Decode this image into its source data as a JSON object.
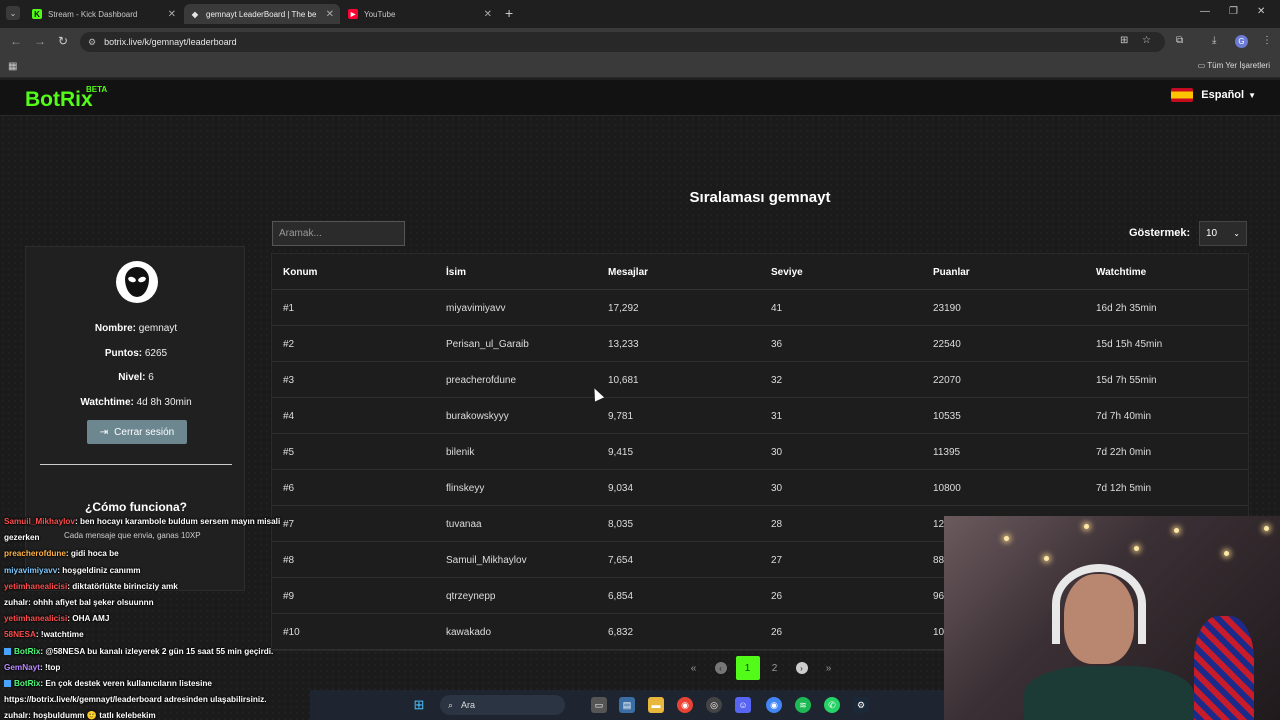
{
  "browser": {
    "tabs": [
      {
        "title": "Stream - Kick Dashboard",
        "icon": "kick-icon",
        "color": "#53fc18"
      },
      {
        "title": "gemnayt LeaderBoard | The be",
        "icon": "botrix-icon",
        "color": "#e6e6e6"
      },
      {
        "title": "YouTube",
        "icon": "youtube-icon",
        "color": "#ff0033"
      }
    ],
    "url": "botrix.live/k/gemnayt/leaderboard",
    "bookmarks_label": "Tüm Yer İşaretleri",
    "profile_initial": "G"
  },
  "site": {
    "logo": "BotRix",
    "beta": "BETA",
    "language": "Español",
    "page_title": "Sıralaması gemnayt",
    "search_placeholder": "Aramak...",
    "show_label": "Göstermek:",
    "show_value": "10"
  },
  "profile": {
    "name_label": "Nombre:",
    "name": "gemnayt",
    "points_label": "Puntos:",
    "points": "6265",
    "level_label": "Nivel:",
    "level": "6",
    "watchtime_label": "Watchtime:",
    "watchtime": "4d 8h 30min",
    "logout": "Cerrar sesión",
    "how_title": "¿Cómo funciona?",
    "how_text": "Cada mensaje que envia, ganas 10XP"
  },
  "table": {
    "headers": [
      "Konum",
      "İsim",
      "Mesajlar",
      "Seviye",
      "Puanlar",
      "Watchtime"
    ],
    "rows": [
      [
        "#1",
        "miyavimiyavv",
        "17,292",
        "41",
        "23190",
        "16d 2h 35min"
      ],
      [
        "#2",
        "Perisan_ul_Garaib",
        "13,233",
        "36",
        "22540",
        "15d 15h 45min"
      ],
      [
        "#3",
        "preacherofdune",
        "10,681",
        "32",
        "22070",
        "15d 7h 55min"
      ],
      [
        "#4",
        "burakowskyyy",
        "9,781",
        "31",
        "10535",
        "7d 7h 40min"
      ],
      [
        "#5",
        "bilenik",
        "9,415",
        "30",
        "11395",
        "7d 22h 0min"
      ],
      [
        "#6",
        "flinskeyy",
        "9,034",
        "30",
        "10800",
        "7d 12h 5min"
      ],
      [
        "#7",
        "tuvanaa",
        "8,035",
        "28",
        "12",
        ""
      ],
      [
        "#8",
        "Samuil_Mikhaylov",
        "7,654",
        "27",
        "88",
        ""
      ],
      [
        "#9",
        "qtrzeynepp",
        "6,854",
        "26",
        "96",
        ""
      ],
      [
        "#10",
        "kawakado",
        "6,832",
        "26",
        "10",
        ""
      ]
    ]
  },
  "pagination": {
    "first": "«",
    "prev": "‹",
    "pages": [
      "1",
      "2"
    ],
    "current": "1",
    "next": "›",
    "last": "»"
  },
  "chat": [
    {
      "user": "Samuil_Mikhaylov",
      "text": ": ben hocayı karambole buldum sersem mayın misali",
      "color": "red"
    },
    {
      "user": "",
      "text": "gezerken",
      "color": ""
    },
    {
      "user": "preacherofdune",
      "text": ": gidi hoca be",
      "color": "yellow"
    },
    {
      "user": "miyavimiyavv",
      "text": ": hoşgeldiniz canımm",
      "color": "blue"
    },
    {
      "user": "yetimhanealicisi",
      "text": ": diktatörlükte birinciziy amk",
      "color": "red"
    },
    {
      "user": "zuhalr",
      "text": ": ohhh afiyet bal şeker olsuunnn",
      "color": ""
    },
    {
      "user": "yetimhanealicisi",
      "text": ": OHA AMJ",
      "color": "red"
    },
    {
      "user": "58NESA",
      "text": ": !watchtime",
      "color": "red"
    },
    {
      "user": "BotRix",
      "text": ": @58NESA bu kanalı izleyerek 2 gün 15 saat 55 min geçirdi.",
      "color": "green"
    },
    {
      "user": "GemNayt",
      "text": ": !top",
      "color": "purple"
    },
    {
      "user": "BotRix",
      "text": ": En çok destek veren kullanıcıların listesine",
      "color": "green"
    },
    {
      "user": "",
      "text": "https://botrix.live/k/gemnayt/leaderboard adresinden ulaşabilirsiniz.",
      "color": ""
    },
    {
      "user": "zuhalr",
      "text": ": hoşbuldumm 🙂 tatlı kelebekim",
      "color": ""
    }
  ],
  "taskbar": {
    "search_label": "Ara"
  }
}
